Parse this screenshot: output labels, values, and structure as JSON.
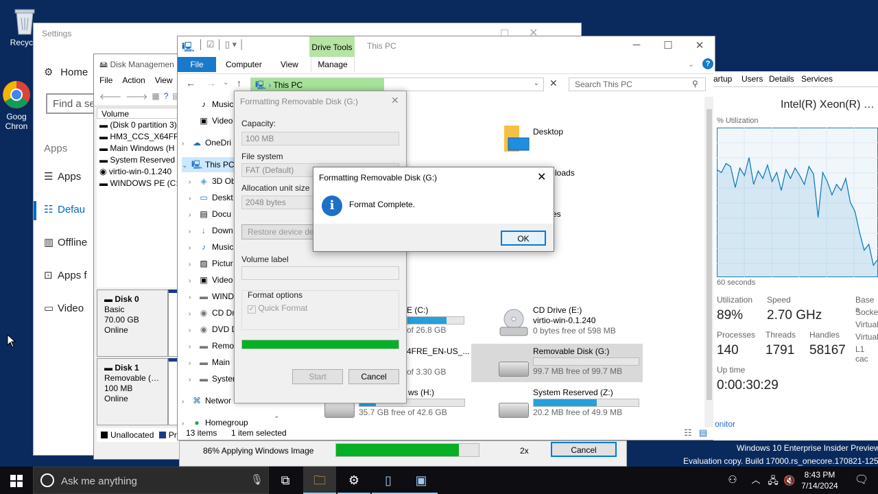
{
  "desktop": {
    "recycle_label": "Recycle",
    "chrome_label1": "Goog",
    "chrome_label2": "Chron",
    "watermark1": "Windows 10 Enterprise Insider Preview",
    "watermark2": "Evaluation copy. Build 17000.rs_onecore.170821-1259"
  },
  "settings": {
    "title": "Settings",
    "home": "Home",
    "find_placeholder": "Find a se",
    "section": "Apps",
    "items": [
      "Apps",
      "Defau",
      "Offline",
      "Apps f",
      "Video"
    ]
  },
  "disk_mgmt": {
    "title": "Disk Managemen",
    "menu": [
      "File",
      "Action",
      "View"
    ],
    "volume_header": "Volume",
    "volumes": [
      "(Disk 0 partition 3)",
      "HM3_CCS_X64FRE",
      "Main Windows (H",
      "System Reserved (",
      "virtio-win-0.1.240",
      "WINDOWS PE (C:)"
    ],
    "disk0": {
      "name": "Disk 0",
      "type": "Basic",
      "size": "70.00 GB",
      "status": "Online"
    },
    "disk1": {
      "name": "Disk 1",
      "type": "Removable (G:)",
      "size": "100 MB",
      "status": "Online"
    },
    "legend_unalloc": "Unallocated",
    "legend_primary": "Pr"
  },
  "explorer": {
    "title": "This PC",
    "drive_tools": "Drive Tools",
    "tabs": [
      "File",
      "Computer",
      "View",
      "Manage"
    ],
    "address": "This PC",
    "search_placeholder": "Search This PC",
    "tree": [
      {
        "label": "Music",
        "icon": "♪"
      },
      {
        "label": "Video",
        "icon": "▣"
      },
      {
        "label": "OneDri",
        "icon": "☁"
      },
      {
        "label": "This PC",
        "icon": "🖳"
      },
      {
        "label": "3D Ob",
        "icon": "◈"
      },
      {
        "label": "Deskt",
        "icon": "▭"
      },
      {
        "label": "Docu",
        "icon": "▤"
      },
      {
        "label": "Down",
        "icon": "↓"
      },
      {
        "label": "Music",
        "icon": "♪"
      },
      {
        "label": "Pictur",
        "icon": "▨"
      },
      {
        "label": "Video",
        "icon": "▣"
      },
      {
        "label": "WIND",
        "icon": "▬"
      },
      {
        "label": "CD Dr",
        "icon": "◉"
      },
      {
        "label": "DVD D",
        "icon": "◉"
      },
      {
        "label": "Remo",
        "icon": "▬"
      },
      {
        "label": "Main",
        "icon": "▬"
      },
      {
        "label": "Syster",
        "icon": "▬"
      },
      {
        "label": "Networ",
        "icon": "⌘"
      },
      {
        "label": "Homegroup",
        "icon": "●"
      }
    ],
    "folders": {
      "desktop": "Desktop",
      "downloads": "loads",
      "pictures": "es"
    },
    "drives": {
      "c_name": "E (C:)",
      "c_free": "of 26.8 GB",
      "hm_name": "4FRE_EN-US_...",
      "hm_free": "of 3.30 GB",
      "h_name": "ws (H:)",
      "h_free": "35.7 GB free of 42.6 GB",
      "e_name": "CD Drive (E:)",
      "e_sub": "virtio-win-0.1.240",
      "e_free": "0 bytes free of 598 MB",
      "g_name": "Removable Disk (G:)",
      "g_free": "99.7 MB free of 99.7 MB",
      "z_name": "System Reserved (Z:)",
      "z_free": "20.2 MB free of 49.9 MB"
    },
    "status_items": "13 items",
    "status_selected": "1 item selected"
  },
  "format_dialog": {
    "title": "Formatting Removable Disk (G:)",
    "capacity_label": "Capacity:",
    "capacity_value": "100 MB",
    "fs_label": "File system",
    "fs_value": "FAT (Default)",
    "alloc_label": "Allocation unit size",
    "alloc_value": "2048 bytes",
    "restore_label": "Restore device defa",
    "volume_label": "Volume label",
    "options_label": "Format options",
    "quick_format": "Quick Format",
    "progress": 100,
    "start": "Start",
    "cancel": "Cancel"
  },
  "message_dialog": {
    "title": "Formatting Removable Disk (G:)",
    "message": "Format Complete.",
    "ok": "OK"
  },
  "task_manager": {
    "tabs": [
      "artup",
      "Users",
      "Details",
      "Services"
    ],
    "cpu_name": "Intel(R) Xeon(R) CPU",
    "util_label": "% Utilization",
    "time_label": "60 seconds",
    "utilization_label": "Utilization",
    "utilization": "89%",
    "speed_label": "Speed",
    "speed": "2.70 GHz",
    "processes_label": "Processes",
    "processes": "140",
    "threads_label": "Threads",
    "threads": "1791",
    "handles_label": "Handles",
    "handles": "58167",
    "uptime_label": "Up time",
    "uptime": "0:00:30:29",
    "right_labels": [
      "Base s",
      "Socket",
      "Virtual",
      "Virtual",
      "L1 cac"
    ],
    "monitor": "onitor",
    "cpu_history": [
      72,
      70,
      76,
      74,
      60,
      73,
      68,
      80,
      62,
      71,
      66,
      75,
      64,
      70,
      58,
      72,
      66,
      73,
      68,
      62,
      74,
      69,
      40,
      70,
      64,
      55,
      62,
      58,
      66,
      50,
      44,
      30,
      18,
      22,
      8,
      12
    ]
  },
  "install": {
    "status": "86% Applying Windows Image",
    "progress": 86,
    "speed": "2x",
    "cancel": "Cancel"
  },
  "taskbar": {
    "search_placeholder": "Ask me anything",
    "time": "8:43 PM",
    "date": "7/14/2024"
  }
}
